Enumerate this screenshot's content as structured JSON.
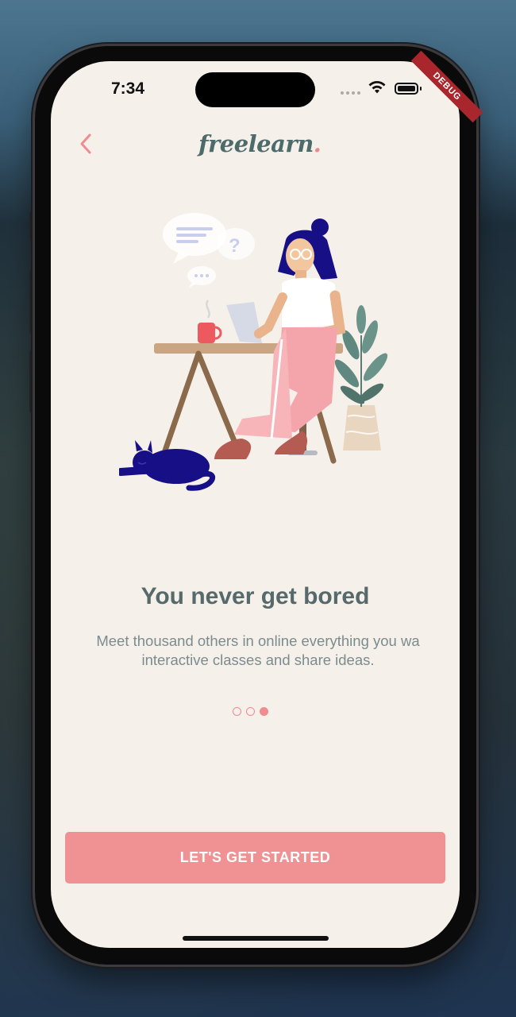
{
  "status_bar": {
    "time": "7:34"
  },
  "debug_banner": "DEBUG",
  "header": {
    "logo_text": "freelearn",
    "logo_dot": "."
  },
  "onboarding": {
    "title": "You never get bored",
    "description": "Meet thousand others in online everything you wa interactive classes and share ideas.",
    "page_count": 3,
    "current_page": 3
  },
  "cta": {
    "label": "LET'S GET STARTED"
  },
  "colors": {
    "accent": "#f09194",
    "background": "#f6f0ea",
    "text_primary": "#566a6c",
    "text_secondary": "#7a8c8e",
    "logo": "#4e6b6c"
  },
  "icons": [
    "back-chevron-icon",
    "wifi-icon",
    "battery-icon"
  ]
}
